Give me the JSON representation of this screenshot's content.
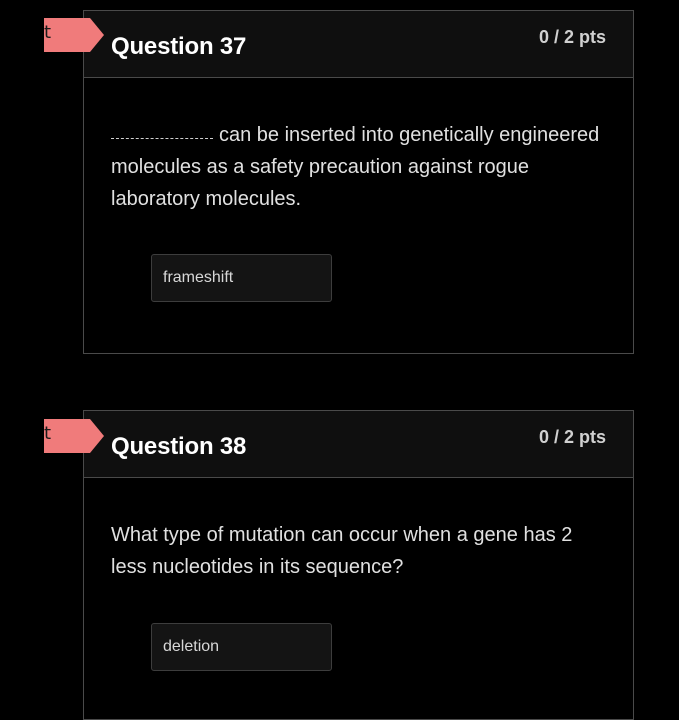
{
  "questions": [
    {
      "title": "Question 37",
      "points": "0 / 2 pts",
      "text_after_blank": "can be inserted into genetically engineered molecules as a safety precaution against rogue laboratory molecules.",
      "answer": "frameshift",
      "flag_letter": "t"
    },
    {
      "title": "Question 38",
      "points": "0 / 2 pts",
      "text": "What type of mutation can occur when a gene has 2 less nucleotides in its sequence?",
      "answer": "deletion",
      "flag_letter": "t"
    }
  ],
  "colors": {
    "background": "#000000",
    "flag": "#f07b7b",
    "border": "#4a4a4a"
  }
}
